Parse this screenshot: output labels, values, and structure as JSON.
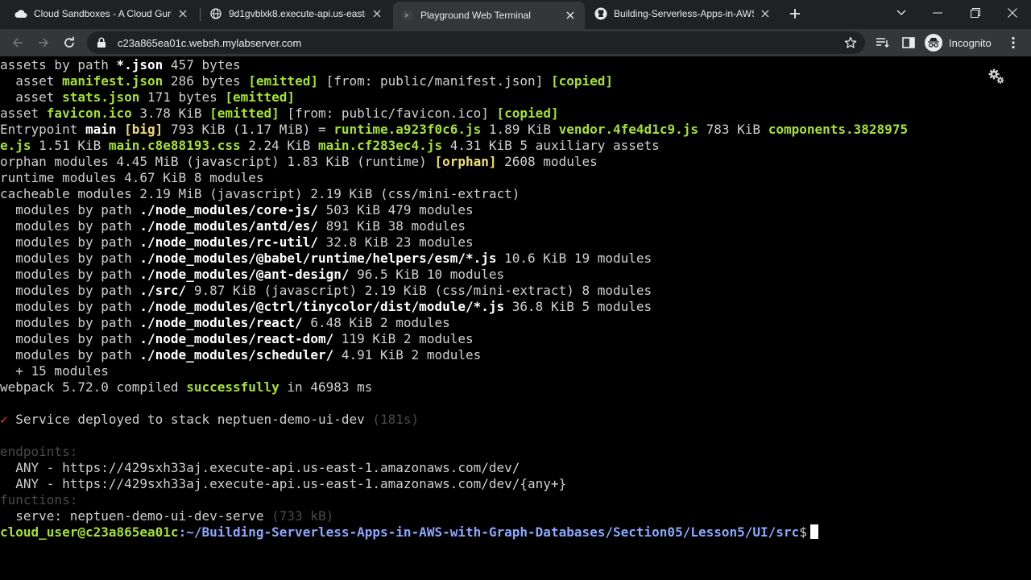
{
  "tabs": [
    {
      "title": "Cloud Sandboxes - A Cloud Guru",
      "icon": "cloud-icon"
    },
    {
      "title": "9d1gvblxk8.execute-api.us-east-1",
      "icon": "globe-icon"
    },
    {
      "title": "Playground Web Terminal",
      "icon": "terminal-icon"
    },
    {
      "title": "Building-Serverless-Apps-in-AWS",
      "icon": "github-icon"
    }
  ],
  "toolbar": {
    "url": "c23a865ea01c.websh.mylabserver.com",
    "incognito_label": "Incognito"
  },
  "terminal": {
    "lines": [
      [
        [
          "d",
          "assets by path "
        ],
        [
          "w",
          "*.json"
        ],
        [
          "d",
          " 457 bytes"
        ]
      ],
      [
        [
          "d",
          "  asset "
        ],
        [
          "g",
          "manifest.json"
        ],
        [
          "d",
          " 286 bytes "
        ],
        [
          "g",
          "[emitted]"
        ],
        [
          "d",
          " [from: public/manifest.json] "
        ],
        [
          "g",
          "[copied]"
        ]
      ],
      [
        [
          "d",
          "  asset "
        ],
        [
          "g",
          "stats.json"
        ],
        [
          "d",
          " 171 bytes "
        ],
        [
          "g",
          "[emitted]"
        ]
      ],
      [
        [
          "d",
          "asset "
        ],
        [
          "g",
          "favicon.ico"
        ],
        [
          "d",
          " 3.78 KiB "
        ],
        [
          "g",
          "[emitted]"
        ],
        [
          "d",
          " [from: public/favicon.ico] "
        ],
        [
          "g",
          "[copied]"
        ]
      ],
      [
        [
          "d",
          "Entrypoint "
        ],
        [
          "w",
          "main"
        ],
        [
          "d",
          " "
        ],
        [
          "y",
          "[big]"
        ],
        [
          "d",
          " 793 KiB (1.17 MiB) = "
        ],
        [
          "g",
          "runtime.a923f0c6.js"
        ],
        [
          "d",
          " 1.89 KiB "
        ],
        [
          "g",
          "vendor.4fe4d1c9.js"
        ],
        [
          "d",
          " 783 KiB "
        ],
        [
          "g",
          "components.3828975"
        ]
      ],
      [
        [
          "g",
          "e.js"
        ],
        [
          "d",
          " 1.51 KiB "
        ],
        [
          "g",
          "main.c8e88193.css"
        ],
        [
          "d",
          " 2.24 KiB "
        ],
        [
          "g",
          "main.cf283ec4.js"
        ],
        [
          "d",
          " 4.31 KiB 5 auxiliary assets"
        ]
      ],
      [
        [
          "d",
          "orphan modules 4.45 MiB (javascript) 1.83 KiB (runtime) "
        ],
        [
          "y",
          "[orphan]"
        ],
        [
          "d",
          " 2608 modules"
        ]
      ],
      [
        [
          "d",
          "runtime modules 4.67 KiB 8 modules"
        ]
      ],
      [
        [
          "d",
          "cacheable modules 2.19 MiB (javascript) 2.19 KiB (css/mini-extract)"
        ]
      ],
      [
        [
          "d",
          "  modules by path "
        ],
        [
          "w",
          "./node_modules/core-js/"
        ],
        [
          "d",
          " 503 KiB 479 modules"
        ]
      ],
      [
        [
          "d",
          "  modules by path "
        ],
        [
          "w",
          "./node_modules/antd/es/"
        ],
        [
          "d",
          " 891 KiB 38 modules"
        ]
      ],
      [
        [
          "d",
          "  modules by path "
        ],
        [
          "w",
          "./node_modules/rc-util/"
        ],
        [
          "d",
          " 32.8 KiB 23 modules"
        ]
      ],
      [
        [
          "d",
          "  modules by path "
        ],
        [
          "w",
          "./node_modules/@babel/runtime/helpers/esm/*.js"
        ],
        [
          "d",
          " 10.6 KiB 19 modules"
        ]
      ],
      [
        [
          "d",
          "  modules by path "
        ],
        [
          "w",
          "./node_modules/@ant-design/"
        ],
        [
          "d",
          " 96.5 KiB 10 modules"
        ]
      ],
      [
        [
          "d",
          "  modules by path "
        ],
        [
          "w",
          "./src/"
        ],
        [
          "d",
          " 9.87 KiB (javascript) 2.19 KiB (css/mini-extract) 8 modules"
        ]
      ],
      [
        [
          "d",
          "  modules by path "
        ],
        [
          "w",
          "./node_modules/@ctrl/tinycolor/dist/module/*.js"
        ],
        [
          "d",
          " 36.8 KiB 5 modules"
        ]
      ],
      [
        [
          "d",
          "  modules by path "
        ],
        [
          "w",
          "./node_modules/react/"
        ],
        [
          "d",
          " 6.48 KiB 2 modules"
        ]
      ],
      [
        [
          "d",
          "  modules by path "
        ],
        [
          "w",
          "./node_modules/react-dom/"
        ],
        [
          "d",
          " 119 KiB 2 modules"
        ]
      ],
      [
        [
          "d",
          "  modules by path "
        ],
        [
          "w",
          "./node_modules/scheduler/"
        ],
        [
          "d",
          " 4.91 KiB 2 modules"
        ]
      ],
      [
        [
          "d",
          "  + 15 modules"
        ]
      ],
      [
        [
          "d",
          "webpack 5.72.0 compiled "
        ],
        [
          "g",
          "successfully"
        ],
        [
          "d",
          " in 46983 ms"
        ]
      ],
      [],
      [
        [
          "r",
          "✓"
        ],
        [
          "d",
          " Service deployed to stack neptuen-demo-ui-dev "
        ],
        [
          "x",
          "(181s)"
        ]
      ],
      [],
      [
        [
          "x",
          "endpoints:"
        ]
      ],
      [
        [
          "d",
          "  ANY - https://429sxh33aj.execute-api.us-east-1.amazonaws.com/dev/"
        ]
      ],
      [
        [
          "d",
          "  ANY - https://429sxh33aj.execute-api.us-east-1.amazonaws.com/dev/{any+}"
        ]
      ],
      [
        [
          "x",
          "functions:"
        ]
      ],
      [
        [
          "d",
          "  serve: neptuen-demo-ui-dev-serve "
        ],
        [
          "x",
          "(733 kB)"
        ]
      ]
    ],
    "prompt_user": "cloud_user@c23a865ea01c",
    "prompt_path": ":~/Building-Serverless-Apps-in-AWS-with-Graph-Databases/Section05/Lesson5/UI/src",
    "prompt_symbol": "$"
  }
}
